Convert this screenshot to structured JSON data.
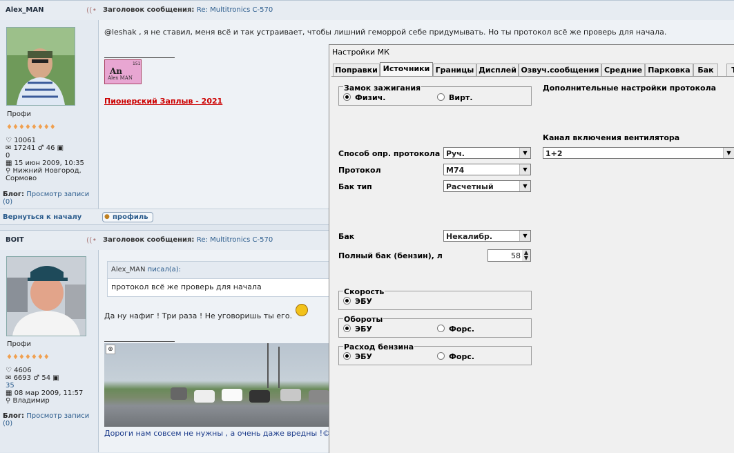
{
  "post1": {
    "username": "Alex_MAN",
    "subject_label": "Заголовок сообщения:",
    "subject": "Re: Multitronics C-570",
    "rank": "Профи",
    "likes": "10061",
    "posts": "17241",
    "gender_count": "46",
    "images_count": "0",
    "joined": "15 июн 2009, 10:35",
    "location": "Нижний Новгород, Сормово",
    "blog_label": "Блог:",
    "blog_link": "Просмотр записи (0)",
    "body": "@leshak , я не ставил, меня всё и так устраивает, чтобы лишний геморрой себе придумывать. Но ты протокол всё же проверь для начала.",
    "sig_badge": "An",
    "sig_badge_sub": "Alex MAN",
    "sig_badge_num": "151",
    "sig_link": "Пионерский Заплыв - 2021"
  },
  "footer": {
    "back_link": "Вернуться к началу",
    "profile_button": "профиль"
  },
  "post2": {
    "username": "BOIT",
    "subject_label": "Заголовок сообщения:",
    "subject": "Re: Multitronics C-570",
    "rank": "Профи",
    "likes": "4606",
    "posts": "6693",
    "gender_count": "54",
    "images_count": "35",
    "joined": "08 мар 2009, 11:57",
    "location": "Владимир",
    "blog_label": "Блог:",
    "blog_link": "Просмотр записи (0)",
    "quote_author": "Alex_MAN",
    "quote_wrote": "писал(а):",
    "quote_text": "протокол всё же проверь для начала",
    "body": "Да ну нафиг ! Три раза ! Не уговоришь ты его.",
    "sig_text": "Дороги нам совсем не нужны , а очень даже вредны !© и"
  },
  "dialog": {
    "title": "Настройки МК",
    "tabs": [
      "Поправки",
      "Источники",
      "Границы",
      "Дисплей",
      "Озвуч.сообщения",
      "Средние",
      "Парковка",
      "Бак",
      "Т"
    ],
    "active_tab": "Источники",
    "ignition": {
      "label": "Замок зажигания",
      "opt1": "Физич.",
      "opt2": "Вирт.",
      "selected": "Физич."
    },
    "extra_label": "Дополнительные настройки протокола",
    "fan_label": "Канал включения вентилятора",
    "fan_value": "1+2",
    "protocol_method_label": "Способ опр. протокола",
    "protocol_method_value": "Руч.",
    "protocol_label": "Протокол",
    "protocol_value": "M74",
    "tank_type_label": "Бак тип",
    "tank_type_value": "Расчетный",
    "tank_label": "Бак",
    "tank_value": "Некалибр.",
    "full_tank_label": "Полный бак (бензин), л",
    "full_tank_value": "58",
    "speed": {
      "label": "Скорость",
      "opt1": "ЭБУ"
    },
    "rpm": {
      "label": "Обороты",
      "opt1": "ЭБУ",
      "opt2": "Форс."
    },
    "fuel": {
      "label": "Расход бензина",
      "opt1": "ЭБУ",
      "opt2": "Форс."
    }
  },
  "colors": {
    "link": "#2a5b8c",
    "sig_red": "#cc0000",
    "dialog_bg": "#f0f0f0",
    "forum_bg": "#eef2f6"
  }
}
